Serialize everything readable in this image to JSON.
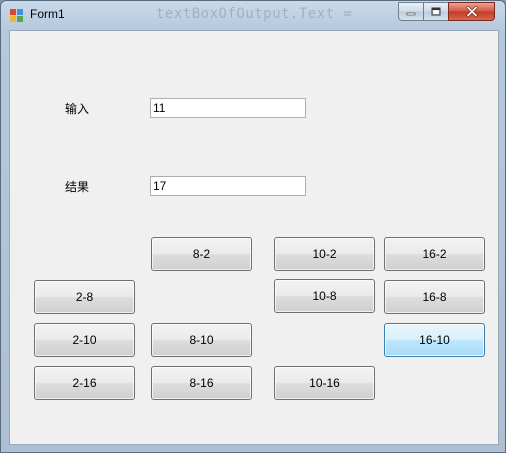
{
  "window": {
    "title": "Form1",
    "background_text": "textBoxOfOutput.Text ="
  },
  "form": {
    "input_label": "输入",
    "input_value": "11",
    "result_label": "结果",
    "result_value": "17"
  },
  "buttons": {
    "b8_2": "8-2",
    "b10_2": "10-2",
    "b16_2": "16-2",
    "b2_8": "2-8",
    "b10_8": "10-8",
    "b16_8": "16-8",
    "b2_10": "2-10",
    "b8_10": "8-10",
    "b16_10": "16-10",
    "b2_16": "2-16",
    "b8_16": "8-16",
    "b10_16": "10-16"
  },
  "colors": {
    "focus_border": "#3c7fb1",
    "close_button": "#c43a22"
  }
}
